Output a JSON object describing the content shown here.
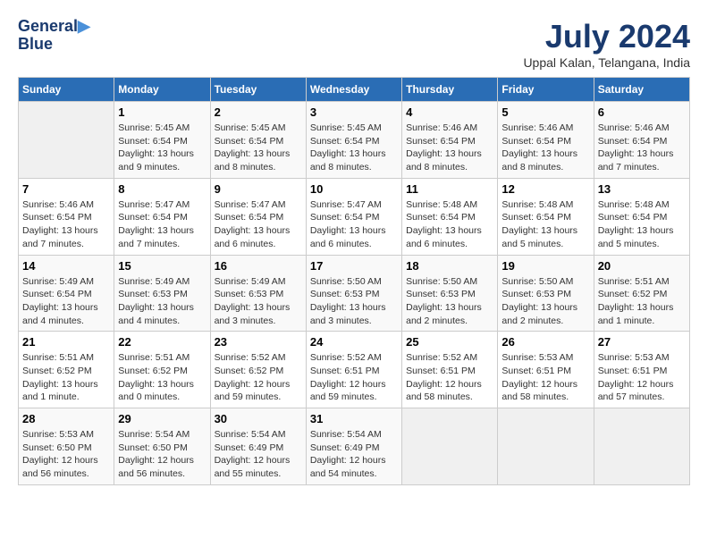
{
  "header": {
    "logo_line1": "General",
    "logo_line2": "Blue",
    "title": "July 2024",
    "location": "Uppal Kalan, Telangana, India"
  },
  "days_of_week": [
    "Sunday",
    "Monday",
    "Tuesday",
    "Wednesday",
    "Thursday",
    "Friday",
    "Saturday"
  ],
  "weeks": [
    [
      {
        "day": "",
        "sunrise": "",
        "sunset": "",
        "daylight": ""
      },
      {
        "day": "1",
        "sunrise": "Sunrise: 5:45 AM",
        "sunset": "Sunset: 6:54 PM",
        "daylight": "Daylight: 13 hours and 9 minutes."
      },
      {
        "day": "2",
        "sunrise": "Sunrise: 5:45 AM",
        "sunset": "Sunset: 6:54 PM",
        "daylight": "Daylight: 13 hours and 8 minutes."
      },
      {
        "day": "3",
        "sunrise": "Sunrise: 5:45 AM",
        "sunset": "Sunset: 6:54 PM",
        "daylight": "Daylight: 13 hours and 8 minutes."
      },
      {
        "day": "4",
        "sunrise": "Sunrise: 5:46 AM",
        "sunset": "Sunset: 6:54 PM",
        "daylight": "Daylight: 13 hours and 8 minutes."
      },
      {
        "day": "5",
        "sunrise": "Sunrise: 5:46 AM",
        "sunset": "Sunset: 6:54 PM",
        "daylight": "Daylight: 13 hours and 8 minutes."
      },
      {
        "day": "6",
        "sunrise": "Sunrise: 5:46 AM",
        "sunset": "Sunset: 6:54 PM",
        "daylight": "Daylight: 13 hours and 7 minutes."
      }
    ],
    [
      {
        "day": "7",
        "sunrise": "Sunrise: 5:46 AM",
        "sunset": "Sunset: 6:54 PM",
        "daylight": "Daylight: 13 hours and 7 minutes."
      },
      {
        "day": "8",
        "sunrise": "Sunrise: 5:47 AM",
        "sunset": "Sunset: 6:54 PM",
        "daylight": "Daylight: 13 hours and 7 minutes."
      },
      {
        "day": "9",
        "sunrise": "Sunrise: 5:47 AM",
        "sunset": "Sunset: 6:54 PM",
        "daylight": "Daylight: 13 hours and 6 minutes."
      },
      {
        "day": "10",
        "sunrise": "Sunrise: 5:47 AM",
        "sunset": "Sunset: 6:54 PM",
        "daylight": "Daylight: 13 hours and 6 minutes."
      },
      {
        "day": "11",
        "sunrise": "Sunrise: 5:48 AM",
        "sunset": "Sunset: 6:54 PM",
        "daylight": "Daylight: 13 hours and 6 minutes."
      },
      {
        "day": "12",
        "sunrise": "Sunrise: 5:48 AM",
        "sunset": "Sunset: 6:54 PM",
        "daylight": "Daylight: 13 hours and 5 minutes."
      },
      {
        "day": "13",
        "sunrise": "Sunrise: 5:48 AM",
        "sunset": "Sunset: 6:54 PM",
        "daylight": "Daylight: 13 hours and 5 minutes."
      }
    ],
    [
      {
        "day": "14",
        "sunrise": "Sunrise: 5:49 AM",
        "sunset": "Sunset: 6:54 PM",
        "daylight": "Daylight: 13 hours and 4 minutes."
      },
      {
        "day": "15",
        "sunrise": "Sunrise: 5:49 AM",
        "sunset": "Sunset: 6:53 PM",
        "daylight": "Daylight: 13 hours and 4 minutes."
      },
      {
        "day": "16",
        "sunrise": "Sunrise: 5:49 AM",
        "sunset": "Sunset: 6:53 PM",
        "daylight": "Daylight: 13 hours and 3 minutes."
      },
      {
        "day": "17",
        "sunrise": "Sunrise: 5:50 AM",
        "sunset": "Sunset: 6:53 PM",
        "daylight": "Daylight: 13 hours and 3 minutes."
      },
      {
        "day": "18",
        "sunrise": "Sunrise: 5:50 AM",
        "sunset": "Sunset: 6:53 PM",
        "daylight": "Daylight: 13 hours and 2 minutes."
      },
      {
        "day": "19",
        "sunrise": "Sunrise: 5:50 AM",
        "sunset": "Sunset: 6:53 PM",
        "daylight": "Daylight: 13 hours and 2 minutes."
      },
      {
        "day": "20",
        "sunrise": "Sunrise: 5:51 AM",
        "sunset": "Sunset: 6:52 PM",
        "daylight": "Daylight: 13 hours and 1 minute."
      }
    ],
    [
      {
        "day": "21",
        "sunrise": "Sunrise: 5:51 AM",
        "sunset": "Sunset: 6:52 PM",
        "daylight": "Daylight: 13 hours and 1 minute."
      },
      {
        "day": "22",
        "sunrise": "Sunrise: 5:51 AM",
        "sunset": "Sunset: 6:52 PM",
        "daylight": "Daylight: 13 hours and 0 minutes."
      },
      {
        "day": "23",
        "sunrise": "Sunrise: 5:52 AM",
        "sunset": "Sunset: 6:52 PM",
        "daylight": "Daylight: 12 hours and 59 minutes."
      },
      {
        "day": "24",
        "sunrise": "Sunrise: 5:52 AM",
        "sunset": "Sunset: 6:51 PM",
        "daylight": "Daylight: 12 hours and 59 minutes."
      },
      {
        "day": "25",
        "sunrise": "Sunrise: 5:52 AM",
        "sunset": "Sunset: 6:51 PM",
        "daylight": "Daylight: 12 hours and 58 minutes."
      },
      {
        "day": "26",
        "sunrise": "Sunrise: 5:53 AM",
        "sunset": "Sunset: 6:51 PM",
        "daylight": "Daylight: 12 hours and 58 minutes."
      },
      {
        "day": "27",
        "sunrise": "Sunrise: 5:53 AM",
        "sunset": "Sunset: 6:51 PM",
        "daylight": "Daylight: 12 hours and 57 minutes."
      }
    ],
    [
      {
        "day": "28",
        "sunrise": "Sunrise: 5:53 AM",
        "sunset": "Sunset: 6:50 PM",
        "daylight": "Daylight: 12 hours and 56 minutes."
      },
      {
        "day": "29",
        "sunrise": "Sunrise: 5:54 AM",
        "sunset": "Sunset: 6:50 PM",
        "daylight": "Daylight: 12 hours and 56 minutes."
      },
      {
        "day": "30",
        "sunrise": "Sunrise: 5:54 AM",
        "sunset": "Sunset: 6:49 PM",
        "daylight": "Daylight: 12 hours and 55 minutes."
      },
      {
        "day": "31",
        "sunrise": "Sunrise: 5:54 AM",
        "sunset": "Sunset: 6:49 PM",
        "daylight": "Daylight: 12 hours and 54 minutes."
      },
      {
        "day": "",
        "sunrise": "",
        "sunset": "",
        "daylight": ""
      },
      {
        "day": "",
        "sunrise": "",
        "sunset": "",
        "daylight": ""
      },
      {
        "day": "",
        "sunrise": "",
        "sunset": "",
        "daylight": ""
      }
    ]
  ]
}
